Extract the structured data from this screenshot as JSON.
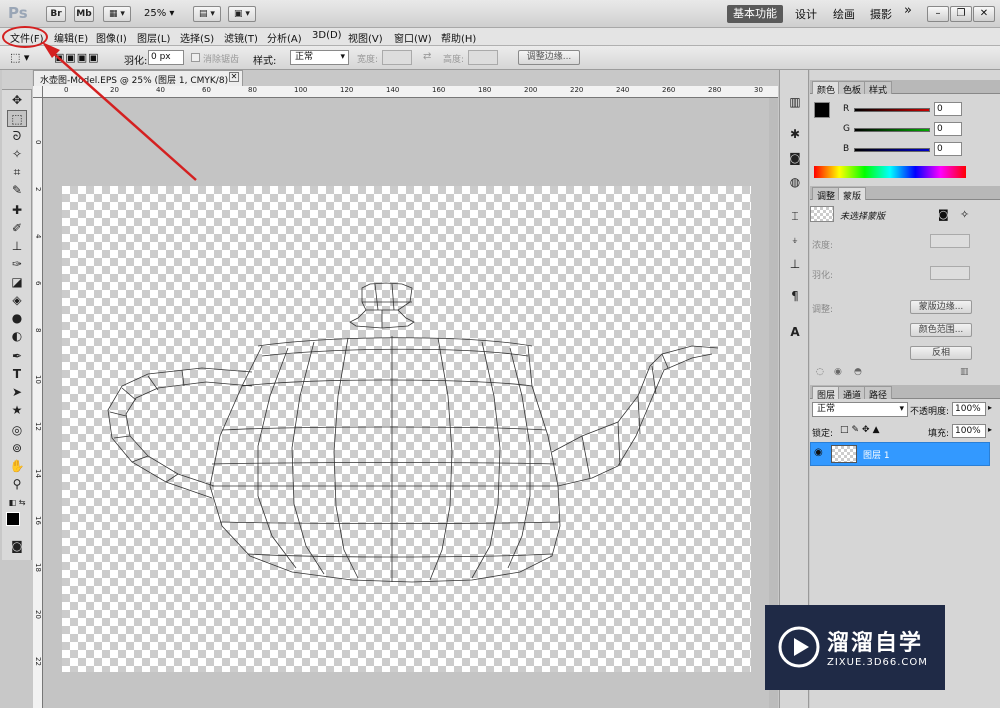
{
  "app": {
    "logo": "Ps",
    "bridge_label": "Br",
    "minibridge_label": "Mb",
    "zoom": "25%",
    "workspaces": [
      "基本功能",
      "设计",
      "绘画",
      "摄影"
    ],
    "more": "»"
  },
  "menu": [
    "文件(F)",
    "编辑(E)",
    "图像(I)",
    "图层(L)",
    "选择(S)",
    "滤镜(T)",
    "分析(A)",
    "3D(D)",
    "视图(V)",
    "窗口(W)",
    "帮助(H)"
  ],
  "options": {
    "feather_label": "羽化:",
    "feather_value": "0 px",
    "antialias_label": "消除锯齿",
    "style_label": "样式:",
    "style_value": "正常",
    "width_label": "宽度:",
    "height_label": "高度:",
    "refine_edge": "调整边缘..."
  },
  "document": {
    "tab_title": "水壶图-Model.EPS @ 25% (图层 1, CMYK/8)",
    "ruler_top": [
      "0",
      "20",
      "40",
      "60",
      "80",
      "100",
      "120",
      "140",
      "160",
      "180",
      "200",
      "220",
      "240",
      "260",
      "280",
      "30"
    ],
    "ruler_left": [
      "0",
      "2",
      "4",
      "6",
      "8",
      "10",
      "12",
      "14",
      "16",
      "18",
      "20",
      "22"
    ]
  },
  "color_panel": {
    "tabs": [
      "颜色",
      "色板",
      "样式"
    ],
    "channels": [
      {
        "name": "R",
        "value": "0",
        "color": "#cc0000"
      },
      {
        "name": "G",
        "value": "0",
        "color": "#00aa00"
      },
      {
        "name": "B",
        "value": "0",
        "color": "#0000cc"
      }
    ]
  },
  "mask_panel": {
    "tabs": [
      "调整",
      "蒙版"
    ],
    "title": "未选择蒙版",
    "density_label": "浓度:",
    "feather_label": "羽化:",
    "refine_label": "调整:",
    "buttons": [
      "蒙版边缘...",
      "颜色范围...",
      "反相"
    ]
  },
  "layers_panel": {
    "tabs": [
      "图层",
      "通道",
      "路径"
    ],
    "blend_mode": "正常",
    "opacity_label": "不透明度:",
    "opacity": "100%",
    "lock_label": "锁定:",
    "fill_label": "填充:",
    "fill": "100%",
    "layers": [
      {
        "name": "图层 1",
        "selected": true
      }
    ]
  },
  "watermark": {
    "title": "溜溜自学",
    "url": "ZIXUE.3D66.COM"
  },
  "colors": {
    "selected_layer": "#3399ff",
    "annotation": "#d42020"
  }
}
